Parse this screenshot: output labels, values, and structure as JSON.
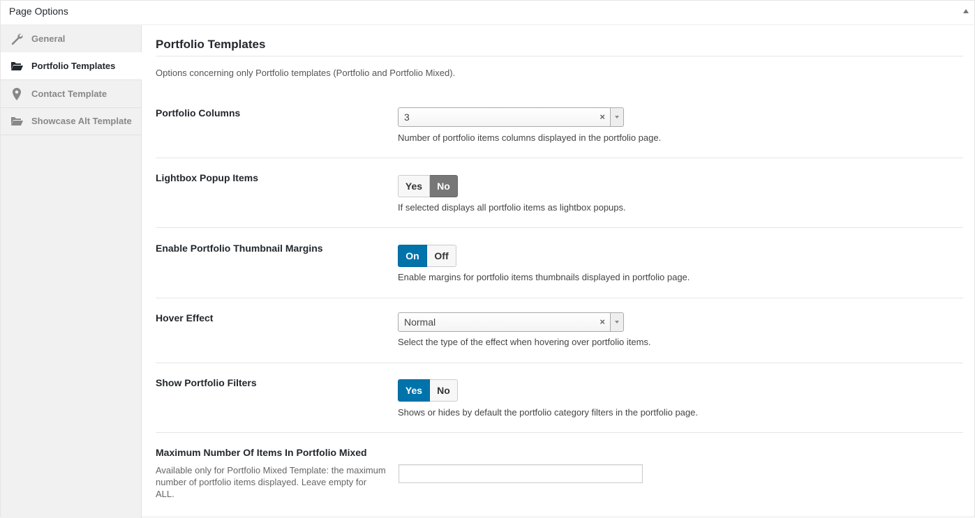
{
  "metabox": {
    "title": "Page Options"
  },
  "sidebar": {
    "items": [
      {
        "label": "General",
        "icon": "wrench-icon",
        "active": false
      },
      {
        "label": "Portfolio Templates",
        "icon": "folder-open-icon",
        "active": true
      },
      {
        "label": "Contact Template",
        "icon": "map-pin-icon",
        "active": false
      },
      {
        "label": "Showcase Alt Template",
        "icon": "folder-open-icon",
        "active": false
      }
    ]
  },
  "main": {
    "title": "Portfolio Templates",
    "description": "Options concerning only Portfolio templates (Portfolio and Portfolio Mixed).",
    "options": {
      "columns": {
        "label": "Portfolio Columns",
        "value": "3",
        "help": "Number of portfolio items columns displayed in the portfolio page."
      },
      "lightbox": {
        "label": "Lightbox Popup Items",
        "yes": "Yes",
        "no": "No",
        "selected": "No",
        "help": "If selected displays all portfolio items as lightbox popups."
      },
      "margins": {
        "label": "Enable Portfolio Thumbnail Margins",
        "on": "On",
        "off": "Off",
        "selected": "On",
        "help": "Enable margins for portfolio items thumbnails displayed in portfolio page."
      },
      "hover": {
        "label": "Hover Effect",
        "value": "Normal",
        "help": "Select the type of the effect when hovering over portfolio items."
      },
      "filters": {
        "label": "Show Portfolio Filters",
        "yes": "Yes",
        "no": "No",
        "selected": "Yes",
        "help": "Shows or hides by default the portfolio category filters in the portfolio page."
      },
      "max_items": {
        "label": "Maximum Number Of Items In Portfolio Mixed",
        "sublabel": "Available only for Portfolio Mixed Template: the maximum number of portfolio items displayed. Leave empty for ALL.",
        "value": ""
      }
    }
  },
  "icons": {
    "clear": "×"
  },
  "colors": {
    "accent": "#0073aa",
    "selected_gray": "#777777"
  }
}
